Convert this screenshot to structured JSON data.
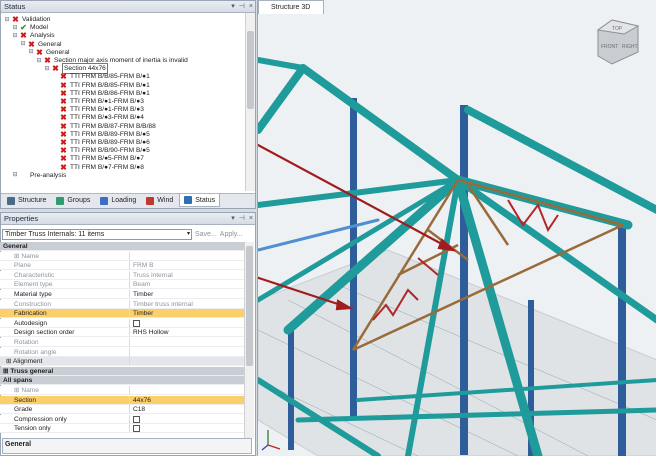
{
  "status_panel": {
    "title": "Status",
    "tree": [
      {
        "label": "Validation",
        "level": 0,
        "icon": "error-x"
      },
      {
        "label": "Model",
        "level": 1,
        "icon": "check"
      },
      {
        "label": "Analysis",
        "level": 1,
        "icon": "error-x"
      },
      {
        "label": "General",
        "level": 2,
        "icon": "error-x"
      },
      {
        "label": "General",
        "level": 3,
        "icon": "error-x"
      },
      {
        "label": "Section major axis moment of inertia is invalid",
        "level": 4,
        "icon": "error-x"
      },
      {
        "label": "Section 44x76",
        "level": 5,
        "icon": "error-x"
      },
      {
        "label": "TTI FRM B/B/85-FRM B/●1",
        "level": 6,
        "icon": "error-x"
      },
      {
        "label": "TTI FRM B/B/85-FRM B/●1",
        "level": 6,
        "icon": "error-x"
      },
      {
        "label": "TTI FRM B/B/86-FRM B/●1",
        "level": 6,
        "icon": "error-x"
      },
      {
        "label": "TTI FRM B/●1-FRM B/●3",
        "level": 6,
        "icon": "error-x"
      },
      {
        "label": "TTI FRM B/●1-FRM B/●3",
        "level": 6,
        "icon": "error-x"
      },
      {
        "label": "TTI FRM B/●3-FRM B/●4",
        "level": 6,
        "icon": "error-x"
      },
      {
        "label": "TTI FRM B/B/87-FRM B/B/88",
        "level": 6,
        "icon": "error-x"
      },
      {
        "label": "TTI FRM B/B/89-FRM B/●5",
        "level": 6,
        "icon": "error-x"
      },
      {
        "label": "TTI FRM B/B/89-FRM B/●6",
        "level": 6,
        "icon": "error-x"
      },
      {
        "label": "TTI FRM B/B/90-FRM B/●5",
        "level": 6,
        "icon": "error-x"
      },
      {
        "label": "TTI FRM B/●5-FRM B/●7",
        "level": 6,
        "icon": "error-x"
      },
      {
        "label": "TTI FRM B/●7-FRM B/●8",
        "level": 6,
        "icon": "error-x"
      },
      {
        "label": "Pre-analysis",
        "level": 1,
        "icon": "plain"
      }
    ],
    "tabs": [
      {
        "label": "Structure",
        "icon": "structure-icon"
      },
      {
        "label": "Groups",
        "icon": "groups-icon"
      },
      {
        "label": "Loading",
        "icon": "loading-icon"
      },
      {
        "label": "Wind",
        "icon": "wind-icon"
      },
      {
        "label": "Status",
        "icon": "status-icon"
      }
    ],
    "active_tab": "Status"
  },
  "properties_panel": {
    "title": "Properties",
    "selection": "Timber Truss Internals: 11 items",
    "save_label": "Save...",
    "apply_label": "Apply...",
    "rows": [
      {
        "type": "section",
        "key": "General",
        "value": ""
      },
      {
        "type": "grey",
        "key": "Name",
        "value": "",
        "prefix": "⊞"
      },
      {
        "type": "grey",
        "key": "Plane",
        "value": "FRM B"
      },
      {
        "type": "grey",
        "key": "Characteristic",
        "value": "Truss internal"
      },
      {
        "type": "grey",
        "key": "Element type",
        "value": "Beam"
      },
      {
        "type": "normal",
        "key": "Material type",
        "value": "Timber"
      },
      {
        "type": "grey",
        "key": "Construction",
        "value": "Timber truss internal"
      },
      {
        "type": "highlight",
        "key": "Fabrication",
        "value": "Timber"
      },
      {
        "type": "normal",
        "key": "Autodesign",
        "value": "",
        "checkbox": true
      },
      {
        "type": "normal",
        "key": "Design section order",
        "value": "RHS Hollow"
      },
      {
        "type": "grey",
        "key": "Rotation",
        "value": ""
      },
      {
        "type": "grey",
        "key": "Rotation angle",
        "value": ""
      },
      {
        "type": "sub",
        "key": "Alignment",
        "value": "",
        "prefix": "⊞"
      },
      {
        "type": "section",
        "key": "Truss general",
        "value": "",
        "prefix": "⊞"
      },
      {
        "type": "section",
        "key": "All spans",
        "value": ""
      },
      {
        "type": "grey",
        "key": "Name",
        "value": "",
        "prefix": "⊞"
      },
      {
        "type": "highlight",
        "key": "Section",
        "value": "44x76"
      },
      {
        "type": "normal",
        "key": "Grade",
        "value": "C18"
      },
      {
        "type": "normal",
        "key": "Compression only",
        "value": "",
        "checkbox": true
      },
      {
        "type": "normal",
        "key": "Tension only",
        "value": "",
        "checkbox": true
      }
    ],
    "description_title": "General"
  },
  "structure_view": {
    "tab_label": "Structure 3D",
    "viewcube": {
      "top": "TOP",
      "front": "FRONT",
      "right": "RIGHT"
    },
    "colors": {
      "beam": "#1e9b9a",
      "column": "#2f5d9a",
      "truss": "#9a6b3a",
      "diagonal": "#b2272a",
      "arrow": "#a01c1e"
    }
  }
}
